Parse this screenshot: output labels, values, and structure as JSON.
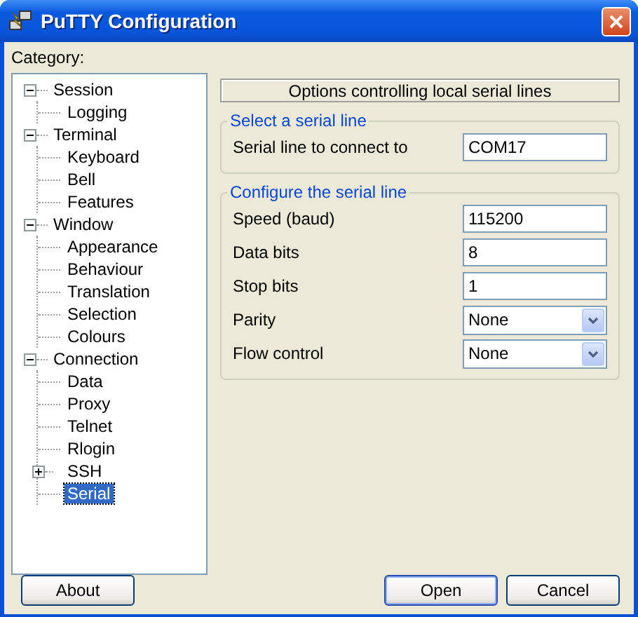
{
  "window": {
    "title": "PuTTY Configuration"
  },
  "category_label": "Category:",
  "tree": [
    {
      "label": "Session",
      "expanded": true,
      "selected": false,
      "children": [
        {
          "label": "Logging",
          "selected": false
        }
      ]
    },
    {
      "label": "Terminal",
      "expanded": true,
      "selected": false,
      "children": [
        {
          "label": "Keyboard",
          "selected": false
        },
        {
          "label": "Bell",
          "selected": false
        },
        {
          "label": "Features",
          "selected": false
        }
      ]
    },
    {
      "label": "Window",
      "expanded": true,
      "selected": false,
      "children": [
        {
          "label": "Appearance",
          "selected": false
        },
        {
          "label": "Behaviour",
          "selected": false
        },
        {
          "label": "Translation",
          "selected": false
        },
        {
          "label": "Selection",
          "selected": false
        },
        {
          "label": "Colours",
          "selected": false
        }
      ]
    },
    {
      "label": "Connection",
      "expanded": true,
      "selected": false,
      "children": [
        {
          "label": "Data",
          "selected": false
        },
        {
          "label": "Proxy",
          "selected": false
        },
        {
          "label": "Telnet",
          "selected": false
        },
        {
          "label": "Rlogin",
          "selected": false
        },
        {
          "label": "SSH",
          "expanded": false,
          "selected": false
        },
        {
          "label": "Serial",
          "selected": true
        }
      ]
    }
  ],
  "panel": {
    "header": "Options controlling local serial lines",
    "groups": [
      {
        "title": "Select a serial line",
        "fields": [
          {
            "kind": "text",
            "label": "Serial line to connect to",
            "value": "COM17"
          }
        ]
      },
      {
        "title": "Configure the serial line",
        "fields": [
          {
            "kind": "text",
            "label": "Speed (baud)",
            "value": "115200"
          },
          {
            "kind": "text",
            "label": "Data bits",
            "value": "8"
          },
          {
            "kind": "text",
            "label": "Stop bits",
            "value": "1"
          },
          {
            "kind": "select",
            "label": "Parity",
            "value": "None"
          },
          {
            "kind": "select",
            "label": "Flow control",
            "value": "None"
          }
        ]
      }
    ]
  },
  "buttons": [
    {
      "label": "About",
      "default": false
    },
    {
      "label": "Open",
      "default": true
    },
    {
      "label": "Cancel",
      "default": false
    }
  ]
}
